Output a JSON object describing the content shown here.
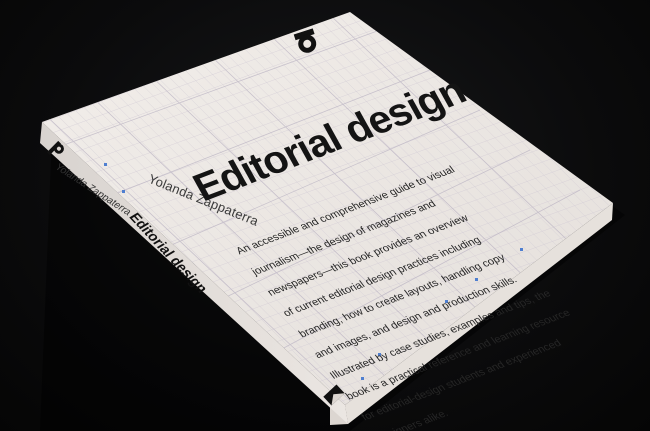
{
  "book": {
    "title": "Editorial design",
    "author": "Yolanda Zappaterra",
    "spine_title": "Editorial design",
    "spine_author": "Yolanda Zappaterra",
    "blurb_lines": [
      "An accessible and comprehensive guide to visual",
      "journalism—the design of magazines and",
      "newspapers—this book provides an overview",
      "of current editorial design practices including",
      "branding, how to create layouts, handling copy",
      "and images, and design and production skills.",
      "Illustrated by case studies, examples and tips, the",
      "book is a practical reference and learning resource",
      "for editorial-design students and experienced",
      "designers alike."
    ],
    "spine_logo": "P",
    "spine_foot_logo": "K",
    "cover_color": "#ece7e2",
    "grid_color": "#c9c3cf",
    "background_color": "#0a0a0b"
  }
}
